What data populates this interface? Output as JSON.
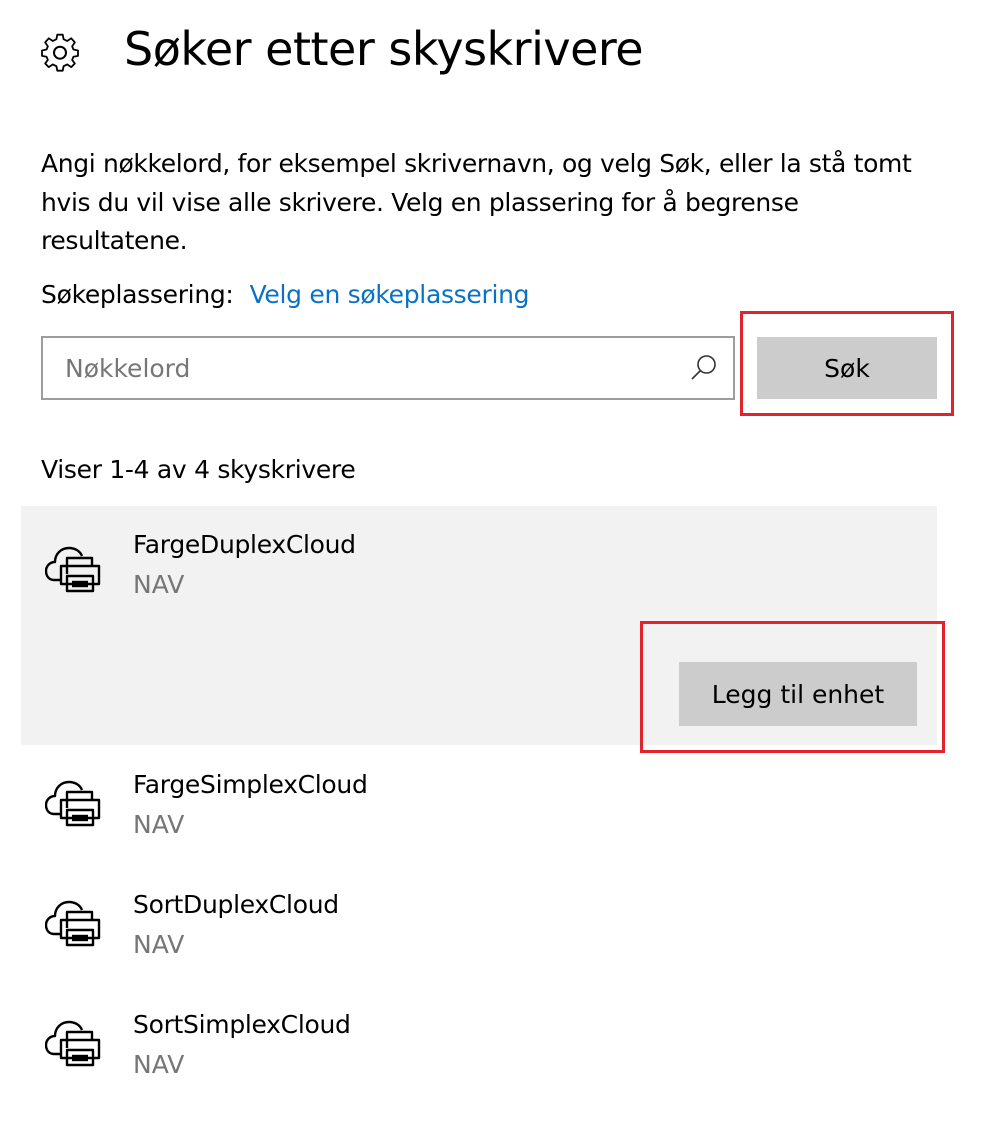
{
  "header": {
    "title": "Søker etter skyskrivere",
    "icon": "gear-icon"
  },
  "description": "Angi nøkkelord, for eksempel skrivernavn, og velg Søk, eller la stå tomt hvis du vil vise alle skrivere. Velg en plassering for å begrense resultatene.",
  "location": {
    "label": "Søkeplassering:",
    "link": "Velg en søkeplassering"
  },
  "search": {
    "placeholder": "Nøkkelord",
    "value": "",
    "button_label": "Søk",
    "icon": "search-icon"
  },
  "results": {
    "count_text": "Viser 1-4 av 4 skyskrivere",
    "add_button_label": "Legg til enhet",
    "items": [
      {
        "name": "FargeDuplexCloud",
        "location": "NAV",
        "icon": "cloud-printer-icon"
      },
      {
        "name": "FargeSimplexCloud",
        "location": "NAV",
        "icon": "cloud-printer-icon"
      },
      {
        "name": "SortDuplexCloud",
        "location": "NAV",
        "icon": "cloud-printer-icon"
      },
      {
        "name": "SortSimplexCloud",
        "location": "NAV",
        "icon": "cloud-printer-icon"
      }
    ]
  },
  "colors": {
    "link": "#0a72c6",
    "highlight": "#e0242e",
    "button": "#cccccc",
    "selected_row": "#f2f2f2"
  }
}
